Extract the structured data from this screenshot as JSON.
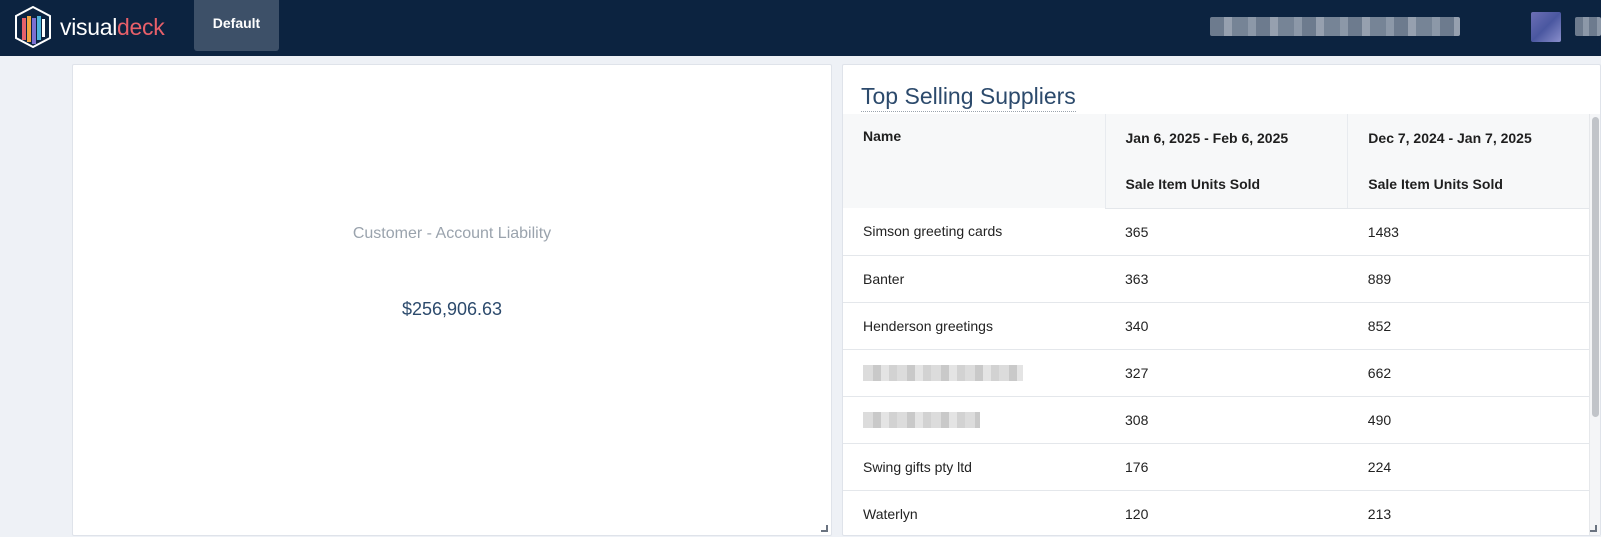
{
  "brand": {
    "name_part1": "visual",
    "name_part2": "deck",
    "accent_color": "#e8606a"
  },
  "topbar": {
    "tab_default": "Default",
    "background": "#0c2340"
  },
  "kpi_widget": {
    "label": "Customer - Account Liability",
    "value": "$256,906.63"
  },
  "suppliers_widget": {
    "title": "Top Selling Suppliers",
    "columns": {
      "name": "Name",
      "period_a": "Jan 6, 2025 - Feb 6, 2025",
      "period_b": "Dec 7, 2024 - Jan 7, 2025",
      "metric_a": "Sale Item Units Sold",
      "metric_b": "Sale Item Units Sold"
    },
    "rows": [
      {
        "name": "Simson greeting cards",
        "a": "365",
        "b": "1483"
      },
      {
        "name": "Banter",
        "a": "363",
        "b": "889"
      },
      {
        "name": "Henderson greetings",
        "a": "340",
        "b": "852"
      },
      {
        "name": "",
        "a": "327",
        "b": "662"
      },
      {
        "name": "",
        "a": "308",
        "b": "490"
      },
      {
        "name": "Swing gifts pty ltd",
        "a": "176",
        "b": "224"
      },
      {
        "name": "Waterlyn",
        "a": "120",
        "b": "213"
      }
    ]
  }
}
